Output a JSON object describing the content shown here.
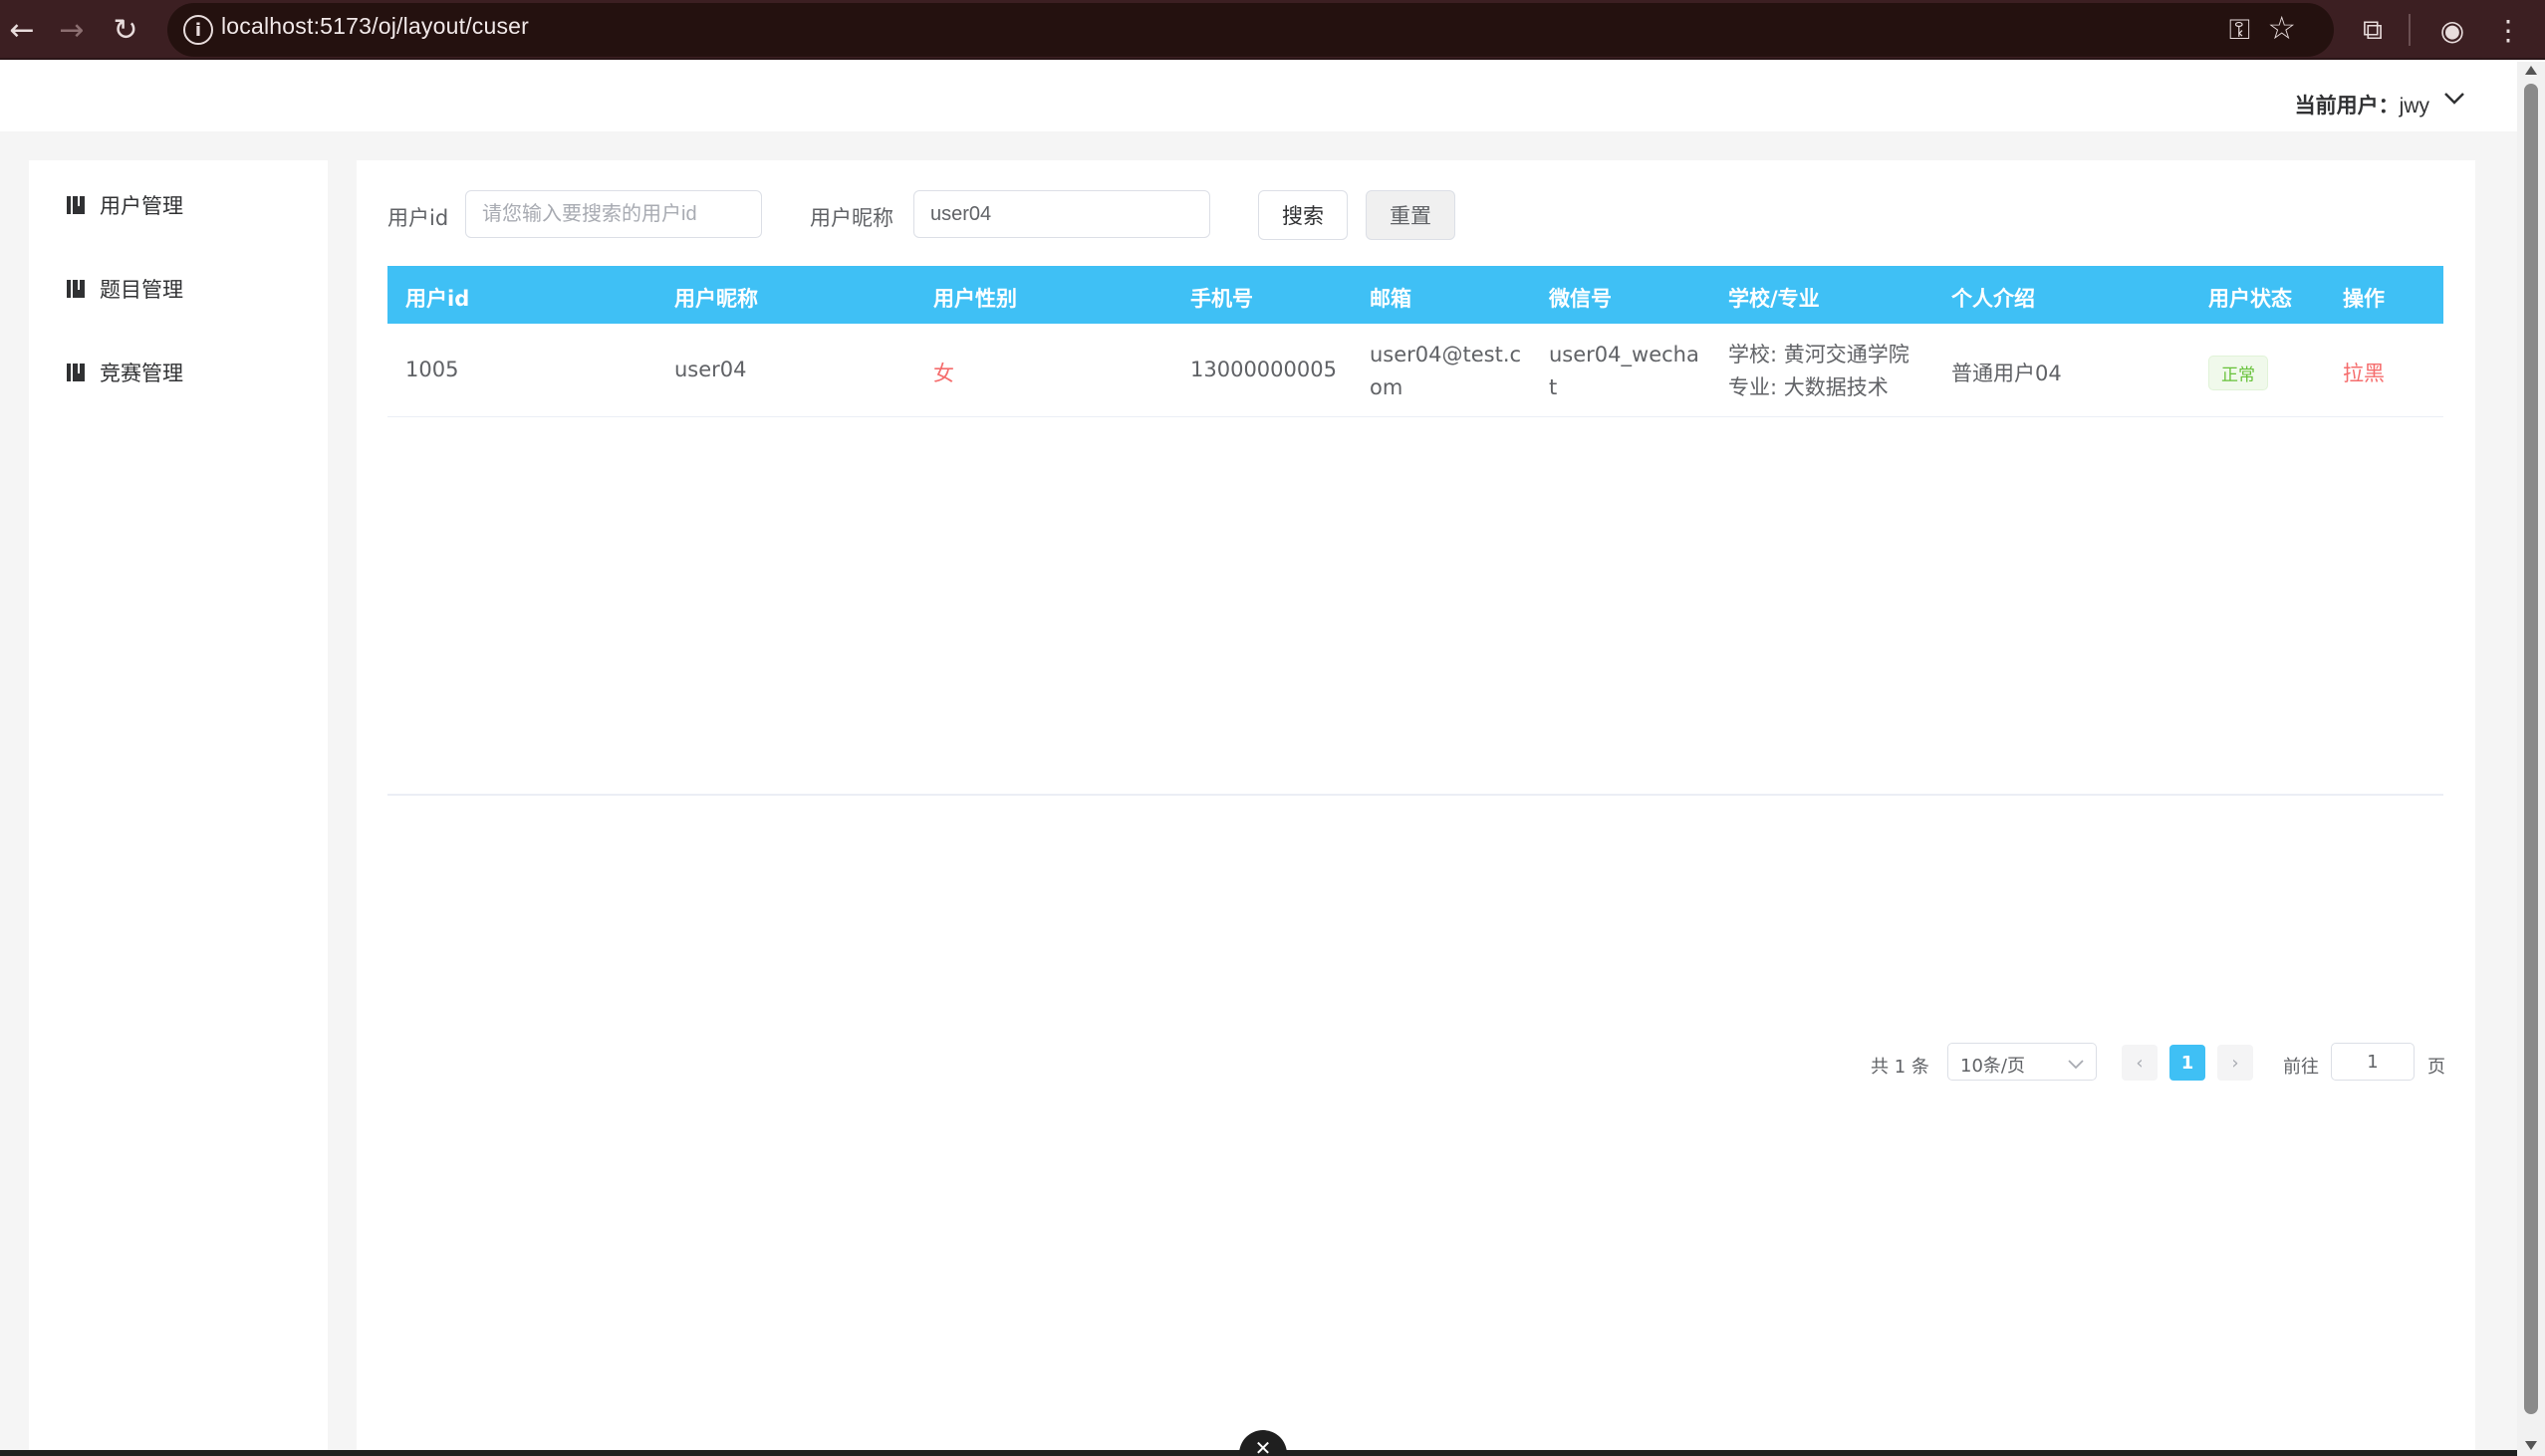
{
  "browser": {
    "url": "localhost:5173/oj/layout/cuser"
  },
  "header": {
    "current_user_label": "当前用户：",
    "current_user_name": "jwy"
  },
  "sidebar": {
    "items": [
      {
        "label": "用户管理"
      },
      {
        "label": "题目管理"
      },
      {
        "label": "竞赛管理"
      }
    ]
  },
  "search": {
    "user_id_label": "用户id",
    "user_id_placeholder": "请您输入要搜索的用户id",
    "user_id_value": "",
    "nickname_label": "用户昵称",
    "nickname_value": "user04",
    "search_button": "搜索",
    "reset_button": "重置"
  },
  "table": {
    "columns": [
      "用户id",
      "用户昵称",
      "用户性别",
      "手机号",
      "邮箱",
      "微信号",
      "学校/专业",
      "个人介绍",
      "用户状态",
      "操作"
    ],
    "rows": [
      {
        "id": "1005",
        "nickname": "user04",
        "gender": "女",
        "phone": "13000000005",
        "email_line1": "user04@test.c",
        "email_line2": "om",
        "wechat_line1": "user04_wecha",
        "wechat_line2": "t",
        "school": "学校: 黄河交通学院",
        "major": "专业: 大数据技术",
        "intro": "普通用户04",
        "status": "正常",
        "action": "拉黑"
      }
    ]
  },
  "pagination": {
    "total": "共 1 条",
    "page_size": "10条/页",
    "prev": "‹",
    "current_page": "1",
    "next": "›",
    "goto_label": "前往",
    "goto_value": "1",
    "page_suffix": "页"
  },
  "colors": {
    "accent": "#3fc0f5",
    "danger": "#f56c6c",
    "success": "#67c23a"
  }
}
